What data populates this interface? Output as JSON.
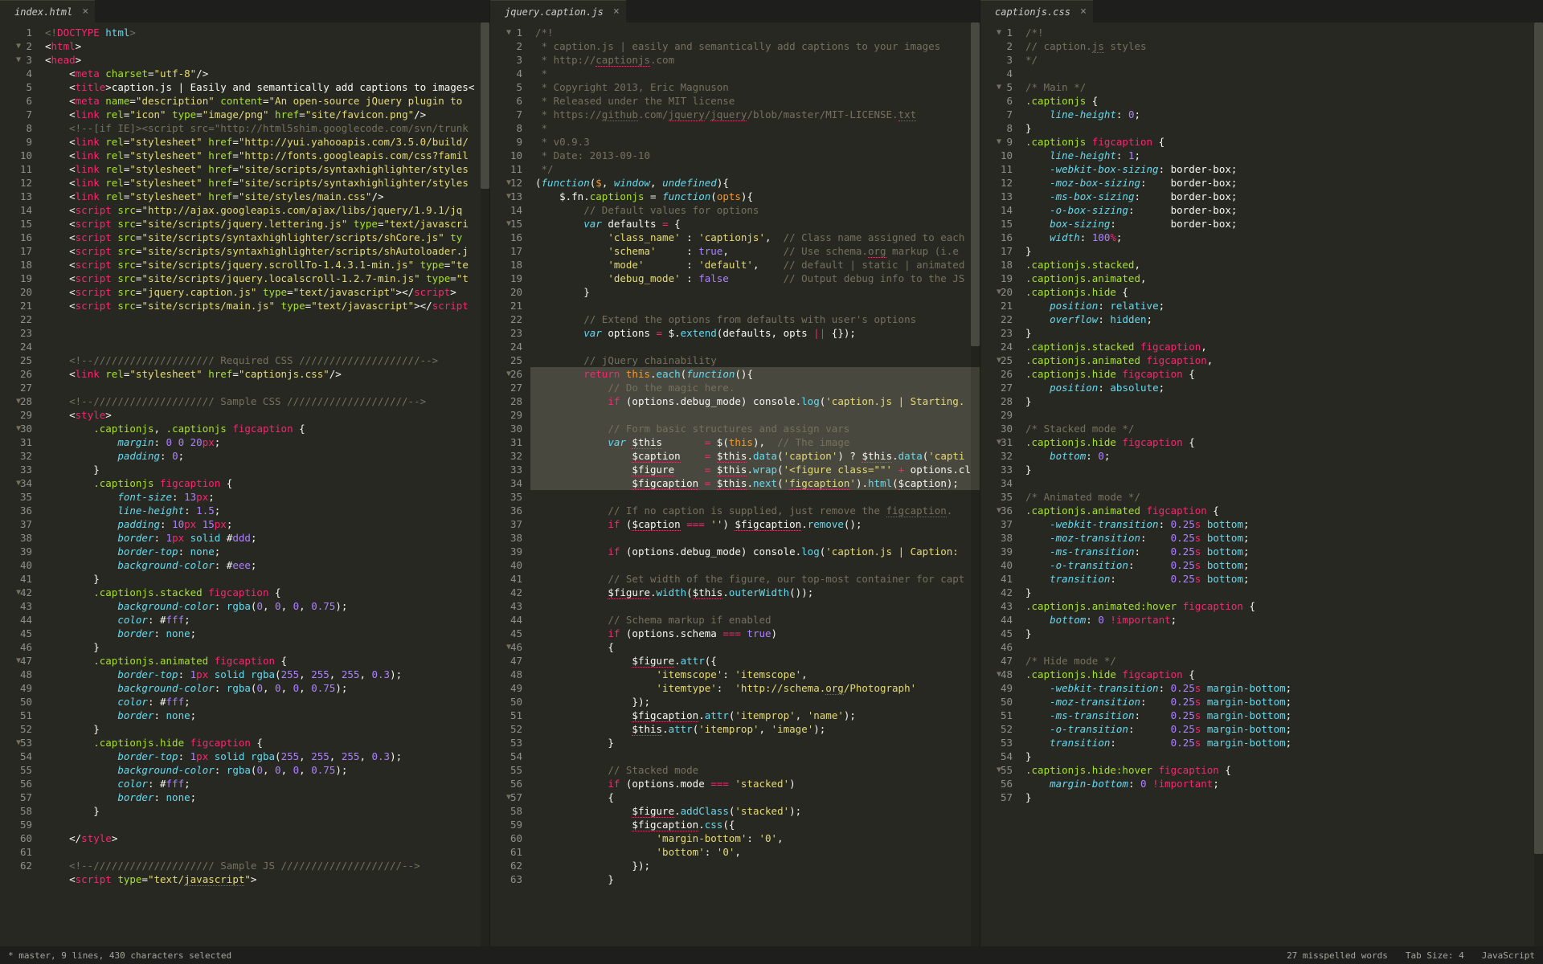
{
  "tabs": {
    "pane1": "index.html",
    "pane2": "jquery.caption.js",
    "pane3": "captionjs.css"
  },
  "status": {
    "left": "* master, 9 lines, 430 characters selected",
    "misspelled": "27 misspelled words",
    "tabsize": "Tab Size: 4",
    "lang": "JavaScript"
  },
  "pane1_lines": 62,
  "pane2_lines": 63,
  "pane3_lines": 57,
  "chart_data": null
}
